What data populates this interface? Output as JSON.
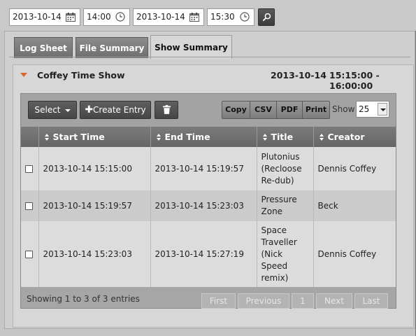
{
  "filters": {
    "start_date": "2013-10-14",
    "start_time": "14:00",
    "end_date": "2013-10-14",
    "end_time": "15:30",
    "search_icon": "search-icon"
  },
  "tabs": [
    {
      "label": "Log Sheet",
      "active": false
    },
    {
      "label": "File Summary",
      "active": false
    },
    {
      "label": "Show Summary",
      "active": true
    }
  ],
  "show": {
    "name": "Coffey Time Show",
    "date": "2013-10-14",
    "time_range": "15:15:00 - 16:00:00"
  },
  "toolbar": {
    "select_label": "Select",
    "create_label": "Create Entry",
    "delete_icon": "trash-icon",
    "export": [
      "Copy",
      "CSV",
      "PDF",
      "Print"
    ],
    "show_label": "Show",
    "page_size": "25"
  },
  "table": {
    "columns": [
      "Start Time",
      "End Time",
      "Title",
      "Creator"
    ],
    "rows": [
      {
        "start": "2013-10-14 15:15:00",
        "end": "2013-10-14 15:19:57",
        "title": [
          "Plutonius",
          "(Recloose",
          "Re-dub)"
        ],
        "creator": "Dennis Coffey"
      },
      {
        "start": "2013-10-14 15:19:57",
        "end": "2013-10-14 15:23:03",
        "title": [
          "Pressure",
          "Zone"
        ],
        "creator": "Beck"
      },
      {
        "start": "2013-10-14 15:23:03",
        "end": "2013-10-14 15:27:19",
        "title": [
          "Space",
          "Traveller",
          "(Nick",
          "Speed",
          "remix)"
        ],
        "creator": "Dennis Coffey"
      }
    ]
  },
  "footer": {
    "info": "Showing 1 to 3 of 3 entries",
    "pager": [
      "First",
      "Previous",
      "1",
      "Next",
      "Last"
    ]
  },
  "colors": {
    "accent_caret": "#e0632a",
    "header_bg": "#6e6e6e",
    "panel_bg": "#d7d7d7"
  }
}
